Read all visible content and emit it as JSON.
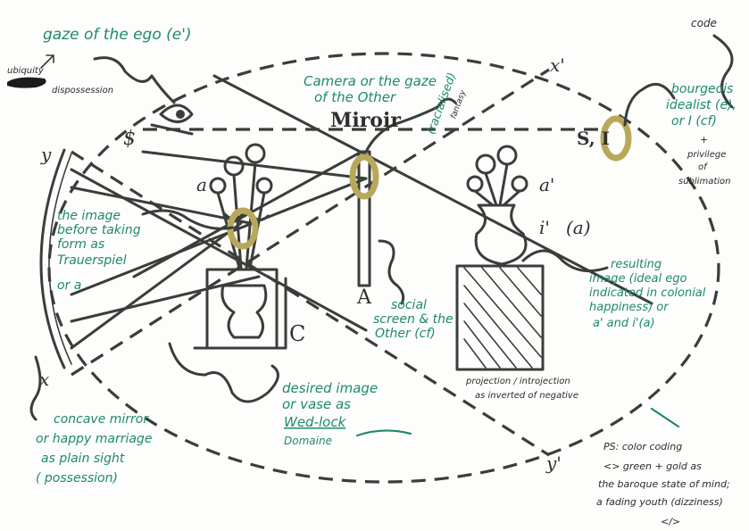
{
  "colors": {
    "ink": "#3a3d3a",
    "green": "#1e8a6a",
    "gold": "#b8a85a",
    "paper": "#fdfdfb"
  },
  "diagram_labels": {
    "mirror": "Miroir",
    "x_prime": "x'",
    "y_prime": "y'",
    "y": "y",
    "x": "x",
    "s_barred": "$",
    "s_i": "S, I",
    "a": "a",
    "a_prime": "a'",
    "i_prime": "i'",
    "i_prime_a": "(a)",
    "A": "A",
    "C": "C"
  },
  "annotations": {
    "gaze_ego": "gaze of the ego (e')",
    "ubiquity_1": "ubiquity",
    "ubiquity_2": "dispossession",
    "camera_1": "Camera or the gaze",
    "camera_2": "of the Other",
    "racialized": "(racialised)",
    "fantasy": "fantasy",
    "code": "code",
    "bourgeois_1": "bourgeois",
    "bourgeois_2": "idealist (e),",
    "bourgeois_3": "or I (cf)",
    "bourgeois_4": "+",
    "bourgeois_5": "privilege",
    "bourgeois_6": "of",
    "bourgeois_7": "sublimation",
    "image_before_1": "the image",
    "image_before_2": "before taking",
    "image_before_3": "form as",
    "image_before_4": "Trauerspiel",
    "image_before_5": "or a",
    "social_1": "social",
    "social_2": "screen & the",
    "social_3": "Other (cf)",
    "resulting_1": "resulting",
    "resulting_2": "image (ideal ego",
    "resulting_3": "indicated in colonial",
    "resulting_4": "happiness) or",
    "resulting_5": "a' and i'(a)",
    "projection_1": "projection / introjection",
    "projection_2": "as inverted of negative",
    "desired_1": "desired image",
    "desired_2": "or vase as",
    "desired_3": "Wed-lock",
    "desired_4": "Domaine",
    "concave_1": "concave mirror",
    "concave_2": "or happy marriage",
    "concave_3": "as plain sight",
    "concave_4": "( possession)",
    "ps_1": "PS: color coding",
    "ps_2": "<> green + gold as",
    "ps_3": "the baroque state of mind;",
    "ps_4": "a fading youth (dizziness)",
    "ps_5": "</>"
  }
}
